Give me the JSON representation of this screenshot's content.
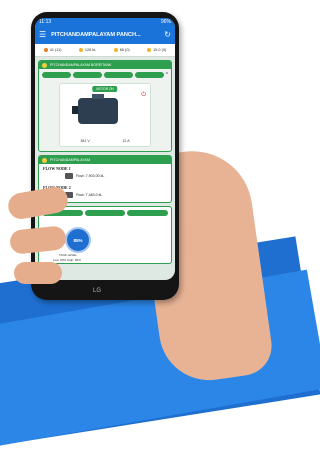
{
  "status_bar": {
    "time": "11:13",
    "battery": "96%"
  },
  "app_bar": {
    "title": "PITCHANDAMPALAYAM PANCH..."
  },
  "stats": [
    {
      "label": "41 (11)"
    },
    {
      "label": "126 kL"
    },
    {
      "label": "66 (0)"
    },
    {
      "label": "15.0 (0)"
    }
  ],
  "pump_card": {
    "title": "PITCHANDAMPALAYAM BORE/TANK"
  },
  "motor": {
    "label": "MOTOR ON",
    "voltage": "381 V",
    "current": "12 A"
  },
  "flow_card": {
    "title": "PITCHANDAMPALAYAM",
    "nodes": [
      {
        "name": "FLOW NODE 1",
        "reading": "Flow: 7,903.00 kL"
      },
      {
        "name": "FLOW NODE 2",
        "reading": "Flow: 7,483.0 kL"
      }
    ]
  },
  "tank": {
    "level": "85%",
    "caption": "TANK LEVEL",
    "low_mark": "Low: 80%",
    "high_mark": "High: 95%"
  },
  "brand": "LG",
  "colors": {
    "primary_blue": "#1a73d8",
    "green": "#2e9e4f",
    "yellow": "#f4d03f"
  }
}
